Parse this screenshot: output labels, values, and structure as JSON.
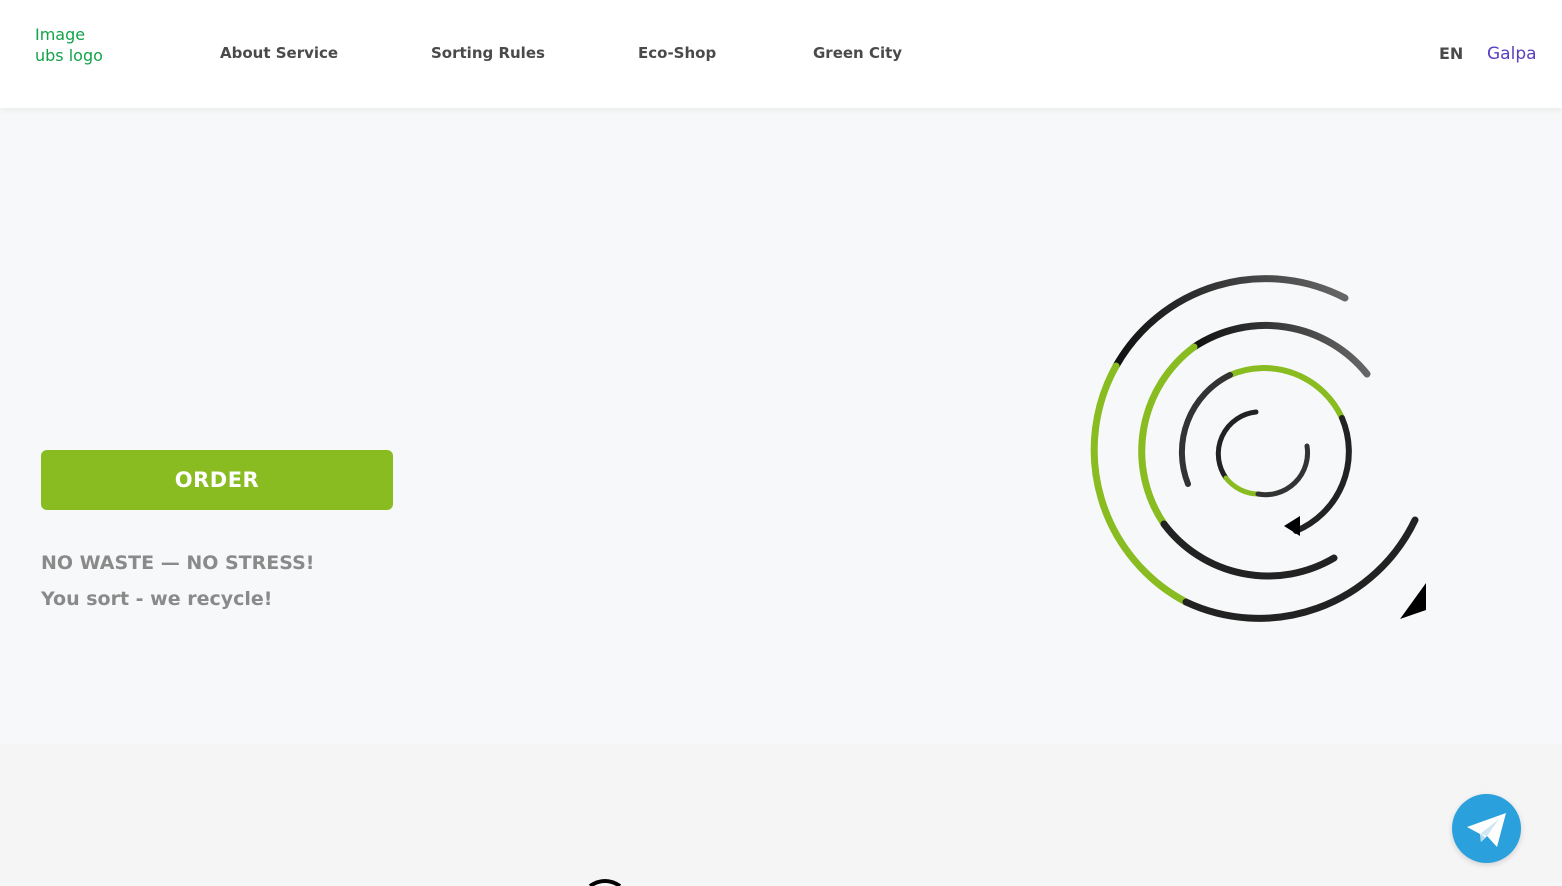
{
  "header": {
    "logo": {
      "line1": "Image",
      "line2": "ubs logo"
    },
    "nav": [
      {
        "label": "About Service"
      },
      {
        "label": "Sorting Rules"
      },
      {
        "label": "Eco-Shop"
      },
      {
        "label": "Green City"
      }
    ],
    "language": "EN",
    "user_name": "Galpa"
  },
  "hero": {
    "order_button": "ORDER",
    "slogan_line1": "NO WASTE — NO STRESS!",
    "slogan_line2": "You sort - we recycle!"
  },
  "icons": {
    "recycle_graphic": "recycle-spiral-icon",
    "telegram": "telegram-icon"
  },
  "colors": {
    "brand_green": "#88bc21",
    "logo_green": "#13a34a",
    "user_purple": "#5a3fbf",
    "telegram_blue": "#2aa0dc"
  }
}
